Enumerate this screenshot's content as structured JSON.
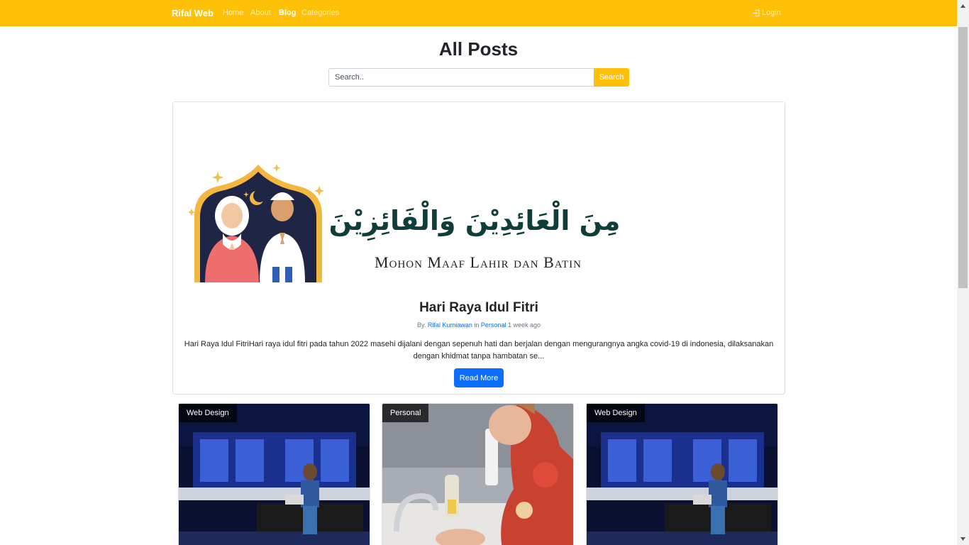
{
  "navbar": {
    "brand": "Rifal Web",
    "links": [
      {
        "label": "Home",
        "active": false
      },
      {
        "label": "About",
        "active": false
      },
      {
        "label": "Blog",
        "active": true
      },
      {
        "label": "Categories",
        "active": false
      }
    ],
    "login_label": "Login",
    "login_icon": "login-icon",
    "color": "#ffc107"
  },
  "main": {
    "title": "All Posts",
    "search": {
      "placeholder": "Search..",
      "button_label": "Search"
    }
  },
  "featured": {
    "image": {
      "arabic_text": "مِنَ الْعَائِدِيْنَ وَالْفَائِزِيْنَ",
      "caption": "Mohon Maaf Lahir dan Batin"
    },
    "title": "Hari Raya Idul Fitri",
    "meta": {
      "by_label": "By.",
      "author": "Rifal Kurniawan",
      "in_label": "in",
      "category": "Personal",
      "time": "1 week ago"
    },
    "excerpt": "Hari Raya Idul FitriHari raya idul fitri pada tahun 2022 masehi dijalani dengan sepenuh hati dan berjalan dengan mengurangnya angka covid-19 di indonesia, dilaksanakan dengan khidmat tanpa hambatan se...",
    "read_more_label": "Read More",
    "button_color": "#0d6efd"
  },
  "posts": [
    {
      "category": "Web Design",
      "image": "server-room-photo"
    },
    {
      "category": "Personal",
      "image": "handwashing-photo"
    },
    {
      "category": "Web Design",
      "image": "server-room-photo"
    }
  ]
}
